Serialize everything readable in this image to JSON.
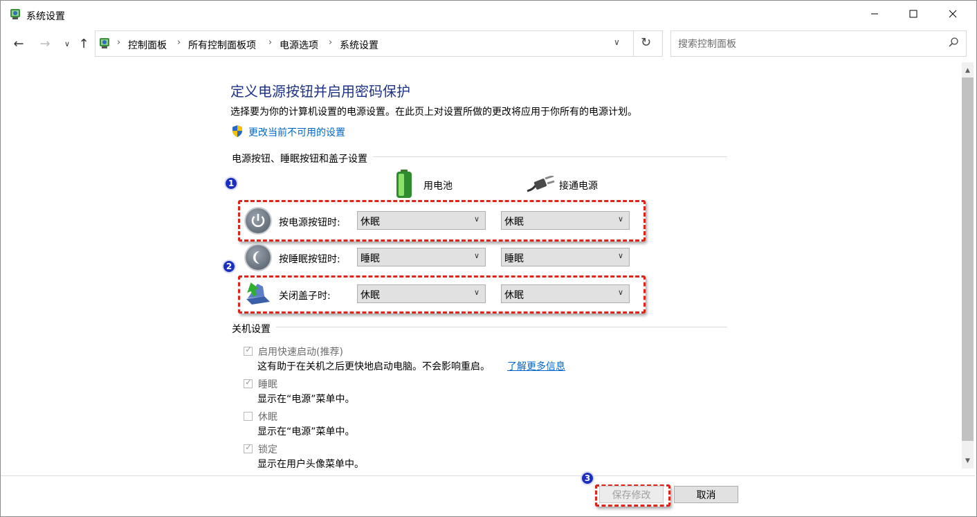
{
  "window": {
    "title": "系统设置"
  },
  "nav": {
    "breadcrumbs": [
      "控制面板",
      "所有控制面板项",
      "电源选项",
      "系统设置"
    ],
    "search_placeholder": "搜索控制面板"
  },
  "page": {
    "heading": "定义电源按钮并启用密码保护",
    "description": "选择要为你的计算机设置的电源设置。在此页上对设置所做的更改将应用于你所有的电源计划。",
    "change_link": "更改当前不可用的设置"
  },
  "buttons_section": {
    "title": "电源按钮、睡眠按钮和盖子设置",
    "col_battery": "用电池",
    "col_plugged": "接通电源",
    "rows": [
      {
        "label": "按电源按钮时:",
        "battery": "休眠",
        "plugged": "休眠"
      },
      {
        "label": "按睡眠按钮时:",
        "battery": "睡眠",
        "plugged": "睡眠"
      },
      {
        "label": "关闭盖子时:",
        "battery": "休眠",
        "plugged": "休眠"
      }
    ]
  },
  "shutdown_section": {
    "title": "关机设置",
    "options": [
      {
        "label": "启用快速启动(推荐)",
        "desc": "这有助于在关机之后更快地启动电脑。不会影响重启。",
        "link": "了解更多信息",
        "checked": true
      },
      {
        "label": "睡眠",
        "desc": "显示在“电源”菜单中。",
        "checked": true
      },
      {
        "label": "休眠",
        "desc": "显示在“电源”菜单中。",
        "checked": false
      },
      {
        "label": "锁定",
        "desc": "显示在用户头像菜单中。",
        "checked": true
      }
    ]
  },
  "annotations": {
    "badge1": "1",
    "badge2": "2",
    "badge3": "3"
  },
  "footer": {
    "save_label": "保存修改",
    "cancel_label": "取消"
  },
  "colors": {
    "heading": "#1e3287",
    "link": "#0066cc",
    "highlight": "#e2231a",
    "badge": "#1a2fbf"
  },
  "icons": {
    "app": "control-panel-icon",
    "power": "power-icon",
    "sleep": "moon-icon",
    "lid": "laptop-lid-icon",
    "battery": "battery-icon",
    "plug": "plug-icon",
    "shield": "uac-shield-icon"
  }
}
